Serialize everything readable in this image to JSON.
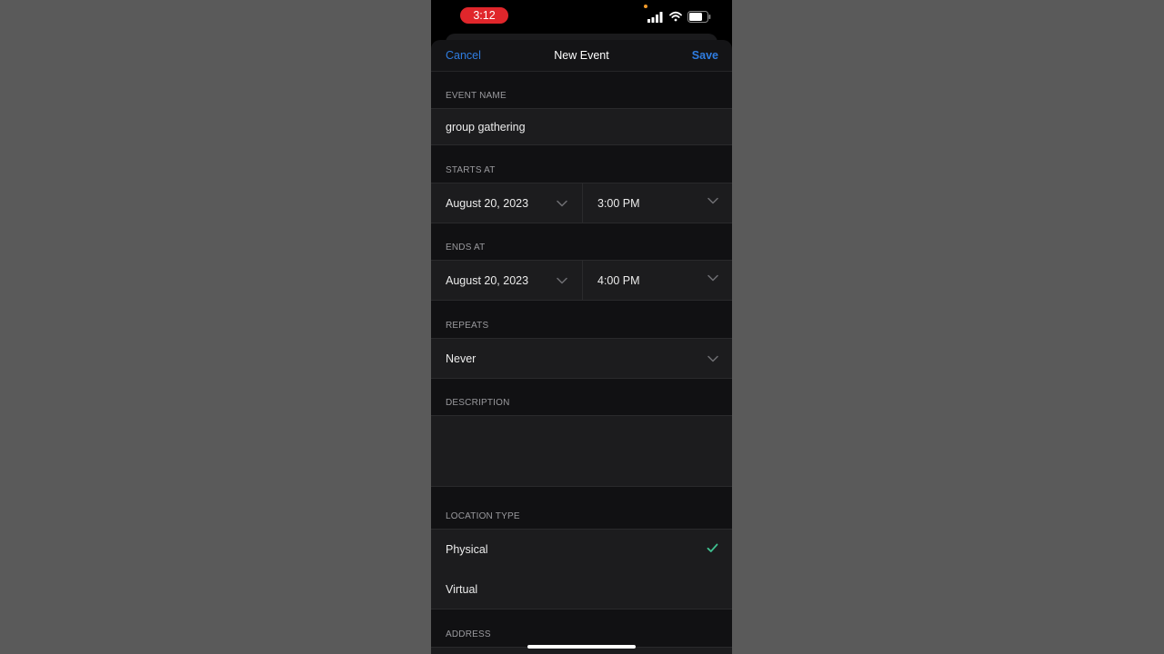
{
  "status": {
    "time": "3:12"
  },
  "nav": {
    "cancel": "Cancel",
    "title": "New Event",
    "save": "Save"
  },
  "event_name": {
    "label": "EVENT NAME",
    "value": "group gathering"
  },
  "starts_at": {
    "label": "STARTS AT",
    "date": "August 20, 2023",
    "time": "3:00 PM"
  },
  "ends_at": {
    "label": "ENDS AT",
    "date": "August 20, 2023",
    "time": "4:00 PM"
  },
  "repeats": {
    "label": "REPEATS",
    "value": "Never"
  },
  "description": {
    "label": "DESCRIPTION",
    "value": ""
  },
  "location_type": {
    "label": "LOCATION TYPE",
    "options": [
      {
        "label": "Physical",
        "selected": true
      },
      {
        "label": "Virtual",
        "selected": false
      }
    ]
  },
  "address": {
    "label": "ADDRESS"
  },
  "colors": {
    "accent": "#2f7de1",
    "check": "#3fbf8f",
    "time_pill": "#e0262b"
  },
  "icons": [
    "signal-icon",
    "wifi-icon",
    "battery-icon",
    "chevron-down-icon",
    "checkmark-icon"
  ]
}
